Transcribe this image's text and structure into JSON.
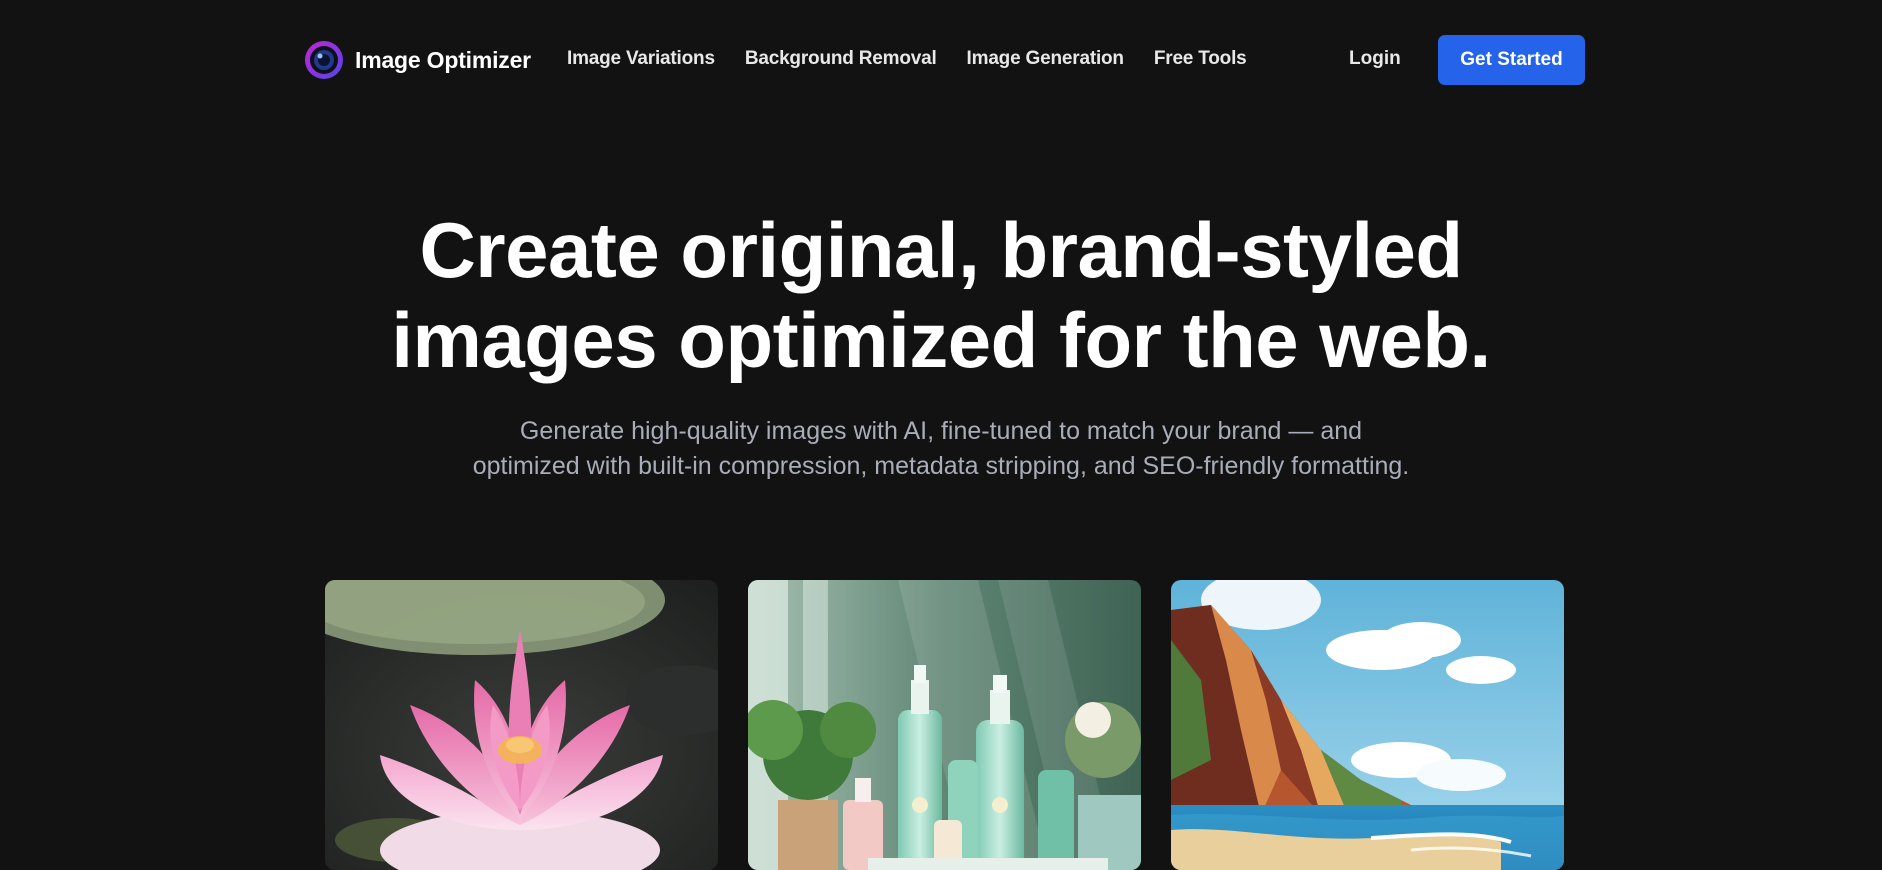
{
  "brand": {
    "name": "Image Optimizer",
    "accent": "#2563eb",
    "logo_gradient": [
      "#a21caf",
      "#3b82f6"
    ]
  },
  "nav": {
    "links": [
      {
        "label": "Image Variations"
      },
      {
        "label": "Background Removal"
      },
      {
        "label": "Image Generation"
      },
      {
        "label": "Free Tools"
      }
    ],
    "login_label": "Login",
    "cta_label": "Get Started"
  },
  "hero": {
    "title_line1": "Create original, brand-styled",
    "title_line2": "images optimized for the web.",
    "subtitle": "Generate high-quality images with AI, fine-tuned to match your brand — and optimized with built-in compression, metadata stripping, and SEO-friendly formatting."
  },
  "gallery": {
    "images": [
      {
        "subject": "pink lotus flower on dark water"
      },
      {
        "subject": "green cosmetic bottles with plants"
      },
      {
        "subject": "illustrated coastal cliffs and beach"
      }
    ]
  }
}
